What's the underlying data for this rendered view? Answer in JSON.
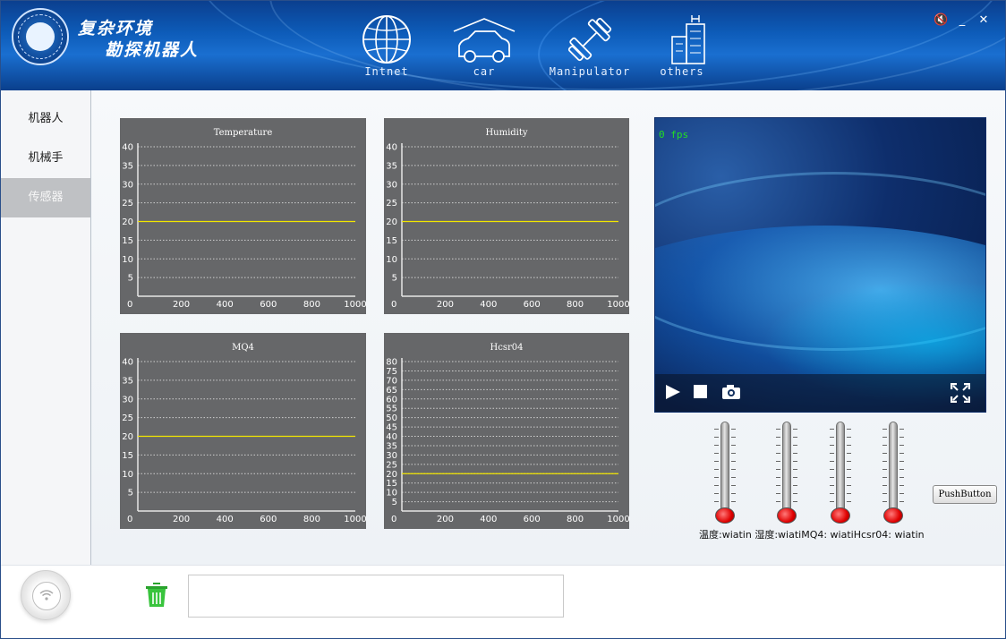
{
  "header": {
    "title_line1": "复杂环境",
    "title_line2": "勘探机器人",
    "nav": [
      {
        "label": "Intnet",
        "icon": "globe-icon"
      },
      {
        "label": "car",
        "icon": "car-icon"
      },
      {
        "label": "Manipulator",
        "icon": "dumbbell-icon"
      },
      {
        "label": "others",
        "icon": "building-icon"
      }
    ],
    "window_controls": [
      "🔇",
      "_",
      "✕"
    ]
  },
  "sidebar": {
    "items": [
      {
        "label": "机器人",
        "active": false
      },
      {
        "label": "机械手",
        "active": false
      },
      {
        "label": "传感器",
        "active": true
      }
    ]
  },
  "charts": {
    "bg_color": "#666769",
    "grid_color": "#d0d0d0",
    "line_color": "#f2e600"
  },
  "chart_data": [
    {
      "type": "line",
      "title": "Temperature",
      "x": [
        0,
        1000
      ],
      "y": [
        20,
        20
      ],
      "xlim": [
        0,
        1000
      ],
      "ylim": [
        0,
        40
      ],
      "xticks": [
        0,
        200,
        400,
        600,
        800,
        1000
      ],
      "yticks": [
        5,
        10,
        15,
        20,
        25,
        30,
        35,
        40
      ],
      "grid": true
    },
    {
      "type": "line",
      "title": "Humidity",
      "x": [
        0,
        1000
      ],
      "y": [
        20,
        20
      ],
      "xlim": [
        0,
        1000
      ],
      "ylim": [
        0,
        40
      ],
      "xticks": [
        0,
        200,
        400,
        600,
        800,
        1000
      ],
      "yticks": [
        5,
        10,
        15,
        20,
        25,
        30,
        35,
        40
      ],
      "grid": true
    },
    {
      "type": "line",
      "title": "MQ4",
      "x": [
        0,
        1000
      ],
      "y": [
        20,
        20
      ],
      "xlim": [
        0,
        1000
      ],
      "ylim": [
        0,
        40
      ],
      "xticks": [
        0,
        200,
        400,
        600,
        800,
        1000
      ],
      "yticks": [
        5,
        10,
        15,
        20,
        25,
        30,
        35,
        40
      ],
      "grid": true
    },
    {
      "type": "line",
      "title": "Hcsr04",
      "x": [
        0,
        1000
      ],
      "y": [
        20,
        20
      ],
      "xlim": [
        0,
        1000
      ],
      "ylim": [
        0,
        80
      ],
      "xticks": [
        0,
        200,
        400,
        600,
        800,
        1000
      ],
      "yticks": [
        5,
        10,
        15,
        20,
        25,
        30,
        35,
        40,
        45,
        50,
        55,
        60,
        65,
        70,
        75,
        80
      ],
      "grid": true
    }
  ],
  "video": {
    "fps_text": "0  fps",
    "controls": [
      "play-icon",
      "stop-icon",
      "camera-icon",
      "fullscreen-icon"
    ]
  },
  "thermometers": [
    {
      "name": "temperature",
      "level": 0
    },
    {
      "name": "humidity",
      "level": 0
    },
    {
      "name": "mq4",
      "level": 0
    },
    {
      "name": "hcsr04",
      "level": 0
    }
  ],
  "status_line": "温度:wiatin 湿度:wiatiMQ4: wiatiHcsr04: wiatin",
  "push_button_label": "PushButton",
  "footer": {
    "log_text": ""
  }
}
